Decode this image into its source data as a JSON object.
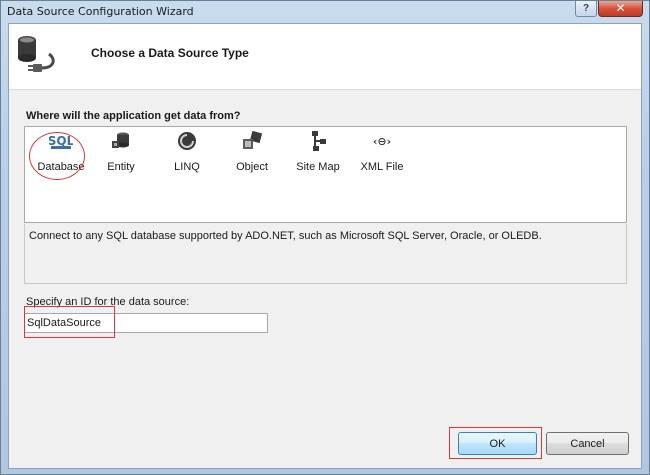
{
  "window": {
    "title": "Data Source Configuration Wizard",
    "help_label": "?",
    "close_label": "✕"
  },
  "header": {
    "title": "Choose a Data Source Type",
    "icon": "database-plug-icon"
  },
  "question": "Where will the application get data from?",
  "types": [
    {
      "label": "Database",
      "icon": "sql-database-icon",
      "selected": true
    },
    {
      "label": "Entity",
      "icon": "entity-icon"
    },
    {
      "label": "LINQ",
      "icon": "linq-icon"
    },
    {
      "label": "Object",
      "icon": "object-icon"
    },
    {
      "label": "Site Map",
      "icon": "site-map-icon"
    },
    {
      "label": "XML File",
      "icon": "xml-file-icon"
    }
  ],
  "database_icon_text": "SQL",
  "xml_icon_text": "‹⊖›",
  "description": "Connect to any SQL database supported by ADO.NET, such as Microsoft SQL Server, Oracle, or OLEDB.",
  "id_field": {
    "label": "Specify an ID for the data source:",
    "value": "SqlDataSource"
  },
  "buttons": {
    "ok": "OK",
    "cancel": "Cancel"
  },
  "colors": {
    "annotation": "#d83a3a",
    "ok_border": "#3c7fb1"
  }
}
